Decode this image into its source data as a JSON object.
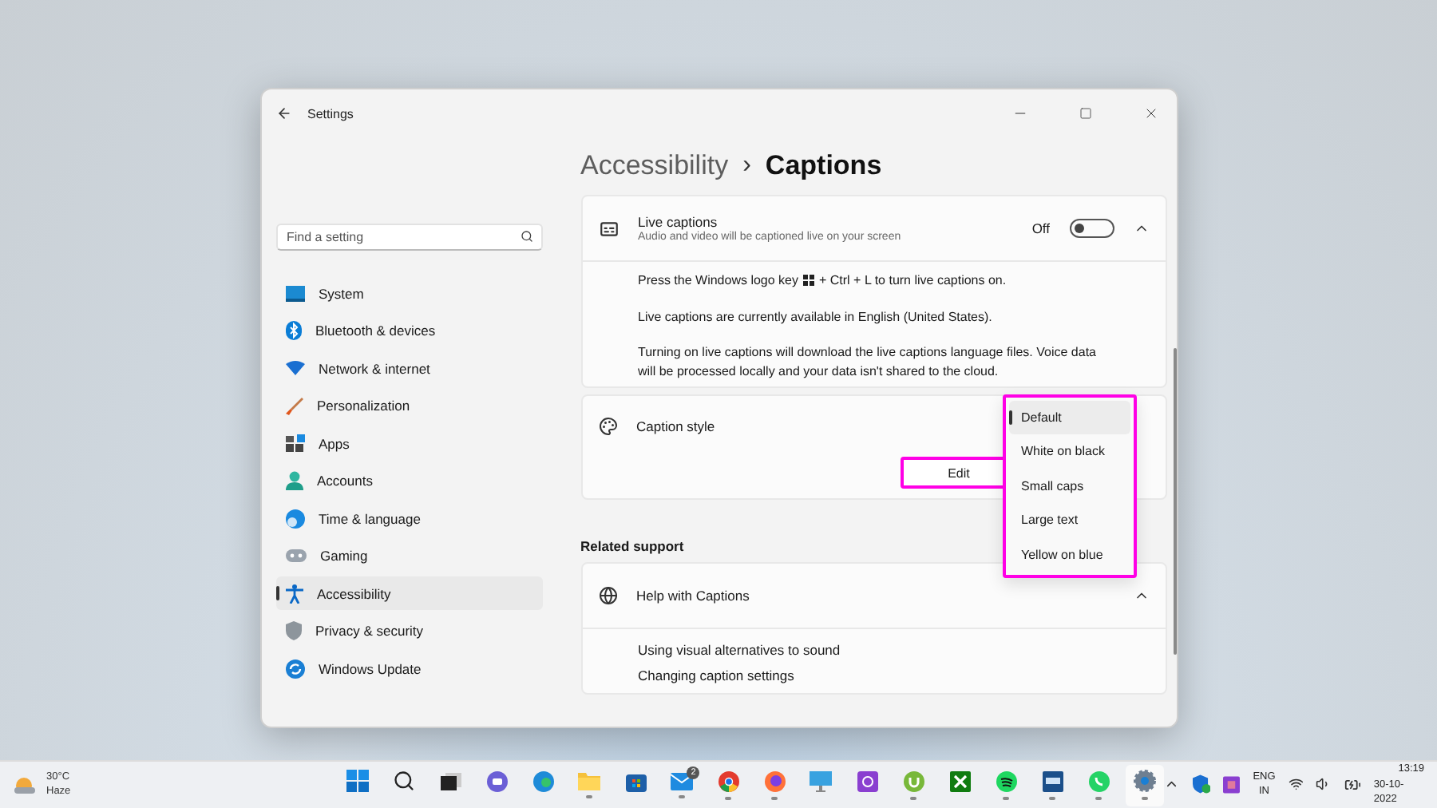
{
  "window": {
    "title": "Settings"
  },
  "search": {
    "placeholder": "Find a setting"
  },
  "sidebar": {
    "items": [
      {
        "label": "System",
        "selected": false
      },
      {
        "label": "Bluetooth & devices",
        "selected": false
      },
      {
        "label": "Network & internet",
        "selected": false
      },
      {
        "label": "Personalization",
        "selected": false
      },
      {
        "label": "Apps",
        "selected": false
      },
      {
        "label": "Accounts",
        "selected": false
      },
      {
        "label": "Time & language",
        "selected": false
      },
      {
        "label": "Gaming",
        "selected": false
      },
      {
        "label": "Accessibility",
        "selected": true
      },
      {
        "label": "Privacy & security",
        "selected": false
      },
      {
        "label": "Windows Update",
        "selected": false
      }
    ]
  },
  "breadcrumb": {
    "parent": "Accessibility",
    "separator": "›",
    "current": "Captions"
  },
  "live_captions": {
    "title": "Live captions",
    "subtitle": "Audio and video will be captioned live on your screen",
    "toggle_label": "Off",
    "on": false,
    "expanded": true,
    "paragraphs": [
      [
        "Press the Windows logo key",
        "+ Ctrl + L to turn live captions on."
      ],
      [
        "Live captions are currently available in English (United States)."
      ],
      [
        "Turning on live captions will download the live captions language files. Voice data will be processed locally and your data isn't shared to the cloud."
      ]
    ]
  },
  "caption_style": {
    "title": "Caption style",
    "edit_button": "Edit",
    "highlighted": true,
    "options": [
      {
        "label": "Default",
        "selected": true
      },
      {
        "label": "White on black",
        "selected": false
      },
      {
        "label": "Small caps",
        "selected": false
      },
      {
        "label": "Large text",
        "selected": false
      },
      {
        "label": "Yellow on blue",
        "selected": false
      }
    ]
  },
  "related_support": {
    "heading": "Related support",
    "title": "Help with Captions",
    "expanded": true,
    "links": [
      "Using visual alternatives to sound",
      "Changing caption settings"
    ]
  },
  "taskbar": {
    "weather": {
      "temperature": "30°C",
      "condition": "Haze"
    },
    "apps": [
      {
        "kind": "start",
        "running": false
      },
      {
        "kind": "search",
        "running": false
      },
      {
        "kind": "taskview",
        "running": false
      },
      {
        "kind": "chat",
        "running": false
      },
      {
        "kind": "edge",
        "running": false
      },
      {
        "kind": "folder",
        "running": true
      },
      {
        "kind": "store",
        "running": false
      },
      {
        "kind": "mail",
        "running": true,
        "badge": "2"
      },
      {
        "kind": "chrome",
        "running": true
      },
      {
        "kind": "firefox",
        "running": true
      },
      {
        "kind": "monitor",
        "running": false
      },
      {
        "kind": "tile",
        "running": false
      },
      {
        "kind": "utorrent",
        "running": true
      },
      {
        "kind": "xbox",
        "running": false
      },
      {
        "kind": "spotify",
        "running": true
      },
      {
        "kind": "panel",
        "running": true
      },
      {
        "kind": "whatsapp",
        "running": true
      },
      {
        "kind": "gear",
        "running": true
      }
    ],
    "language": [
      "ENG",
      "IN"
    ],
    "time": "13:19",
    "date": "30-10-2022"
  }
}
